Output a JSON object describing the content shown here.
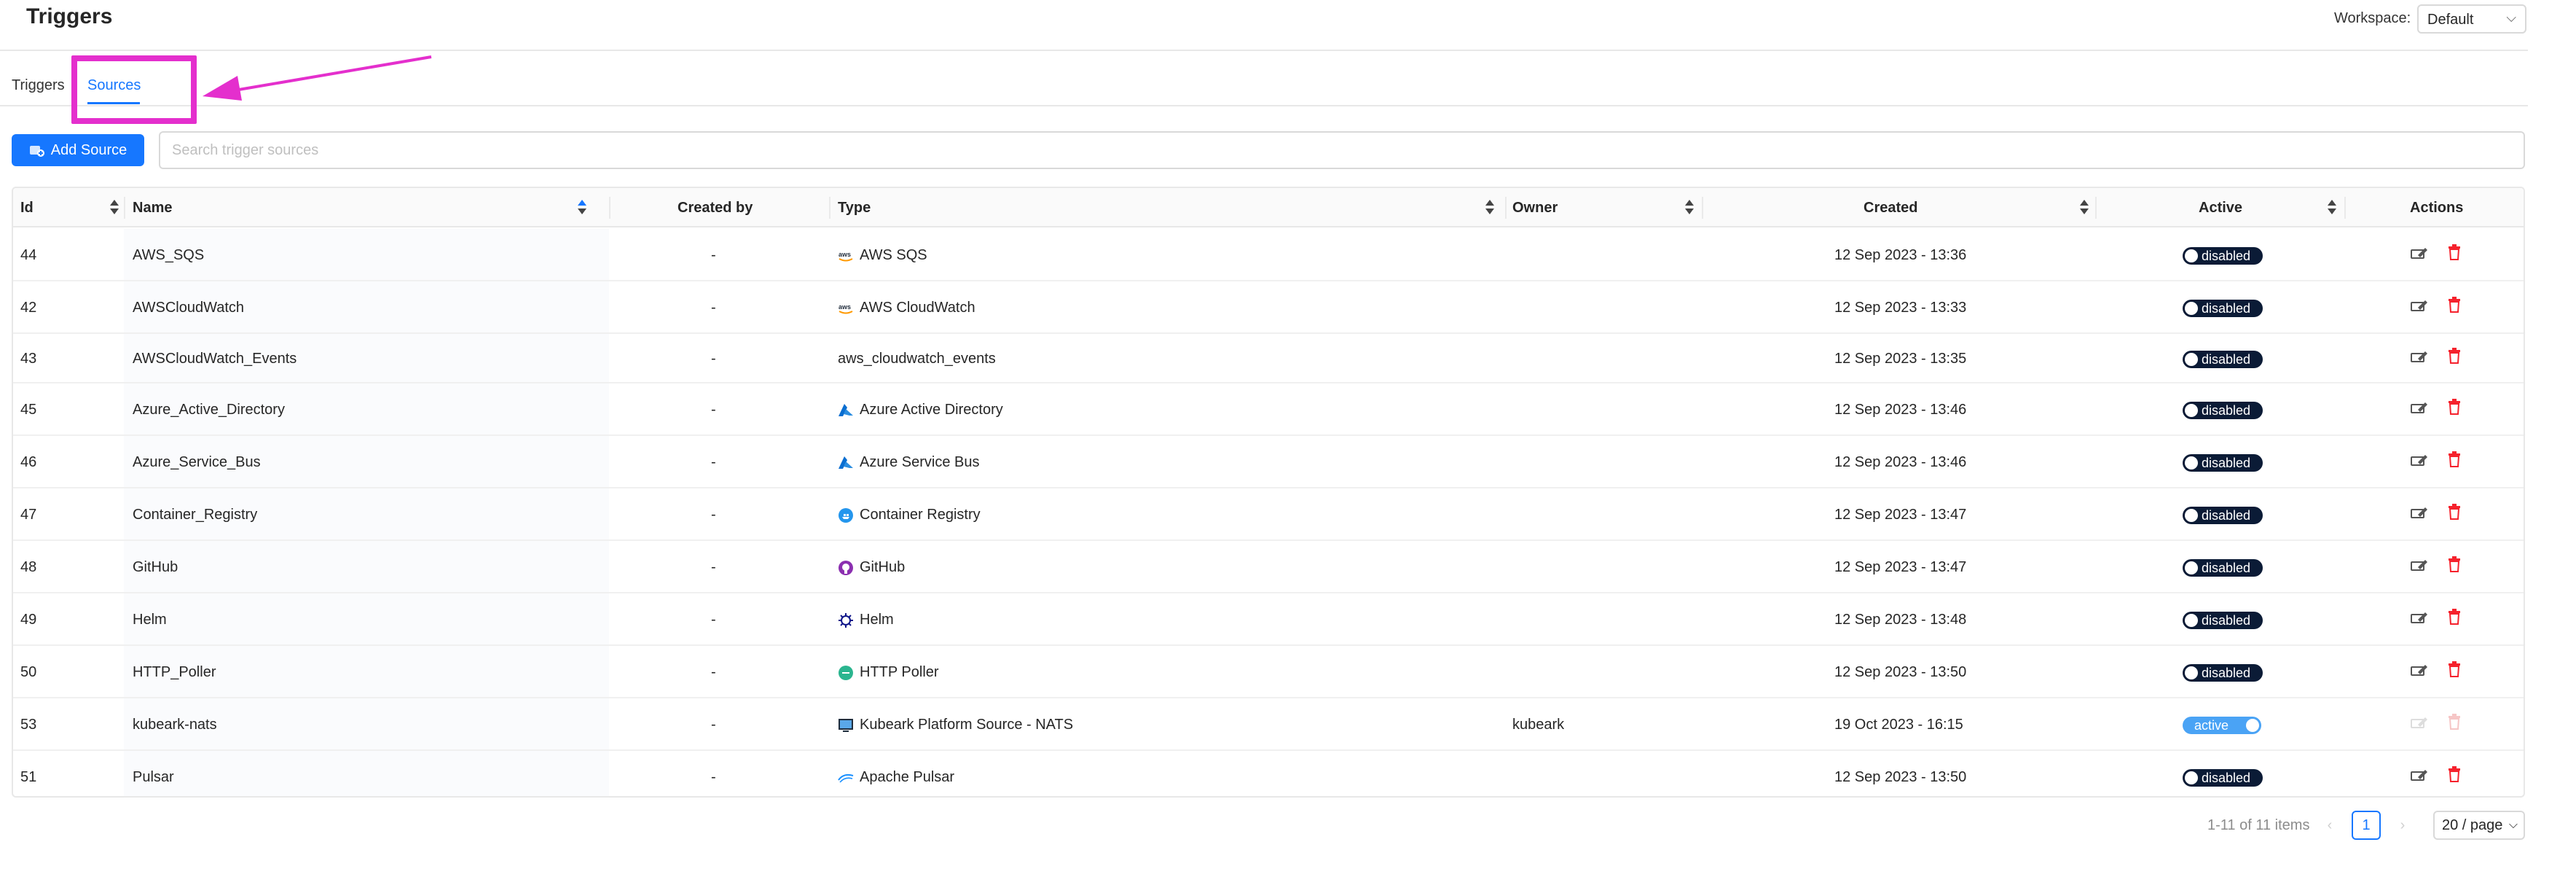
{
  "header": {
    "title": "Triggers",
    "workspace_label": "Workspace:",
    "workspace_value": "Default"
  },
  "tabs": [
    {
      "label": "Triggers",
      "active": false
    },
    {
      "label": "Sources",
      "active": true
    }
  ],
  "toolbar": {
    "add_label": "Add Source",
    "search_placeholder": "Search trigger sources"
  },
  "table": {
    "columns": [
      "Id",
      "Name",
      "Created by",
      "Type",
      "Owner",
      "Created",
      "Active",
      "Actions"
    ],
    "rows": [
      {
        "id": "44",
        "name": "AWS_SQS",
        "created_by": "-",
        "type": "AWS SQS",
        "type_icon": "aws-icon",
        "owner": "",
        "created": "12 Sep 2023 - 13:36",
        "active": "disabled",
        "enabled": false
      },
      {
        "id": "42",
        "name": "AWSCloudWatch",
        "created_by": "-",
        "type": "AWS CloudWatch",
        "type_icon": "aws-icon",
        "owner": "",
        "created": "12 Sep 2023 - 13:33",
        "active": "disabled",
        "enabled": false
      },
      {
        "id": "43",
        "name": "AWSCloudWatch_Events",
        "created_by": "-",
        "type": "aws_cloudwatch_events",
        "type_icon": "",
        "owner": "",
        "created": "12 Sep 2023 - 13:35",
        "active": "disabled",
        "enabled": false
      },
      {
        "id": "45",
        "name": "Azure_Active_Directory",
        "created_by": "-",
        "type": "Azure Active Directory",
        "type_icon": "azure-icon",
        "owner": "",
        "created": "12 Sep 2023 - 13:46",
        "active": "disabled",
        "enabled": false
      },
      {
        "id": "46",
        "name": "Azure_Service_Bus",
        "created_by": "-",
        "type": "Azure Service Bus",
        "type_icon": "azure-icon",
        "owner": "",
        "created": "12 Sep 2023 - 13:46",
        "active": "disabled",
        "enabled": false
      },
      {
        "id": "47",
        "name": "Container_Registry",
        "created_by": "-",
        "type": "Container Registry",
        "type_icon": "container-registry-icon",
        "owner": "",
        "created": "12 Sep 2023 - 13:47",
        "active": "disabled",
        "enabled": false
      },
      {
        "id": "48",
        "name": "GitHub",
        "created_by": "-",
        "type": "GitHub",
        "type_icon": "github-icon",
        "owner": "",
        "created": "12 Sep 2023 - 13:47",
        "active": "disabled",
        "enabled": false
      },
      {
        "id": "49",
        "name": "Helm",
        "created_by": "-",
        "type": "Helm",
        "type_icon": "helm-icon",
        "owner": "",
        "created": "12 Sep 2023 - 13:48",
        "active": "disabled",
        "enabled": false
      },
      {
        "id": "50",
        "name": "HTTP_Poller",
        "created_by": "-",
        "type": "HTTP Poller",
        "type_icon": "http-poller-icon",
        "owner": "",
        "created": "12 Sep 2023 - 13:50",
        "active": "disabled",
        "enabled": false
      },
      {
        "id": "53",
        "name": "kubeark-nats",
        "created_by": "-",
        "type": "Kubeark Platform Source - NATS",
        "type_icon": "kubeark-icon",
        "owner": "kubeark",
        "created": "19 Oct 2023 - 16:15",
        "active": "active",
        "enabled": true
      },
      {
        "id": "51",
        "name": "Pulsar",
        "created_by": "-",
        "type": "Apache Pulsar",
        "type_icon": "pulsar-icon",
        "owner": "",
        "created": "12 Sep 2023 - 13:50",
        "active": "disabled",
        "enabled": false
      }
    ]
  },
  "pagination": {
    "total_text": "1-11 of 11 items",
    "current_page": "1",
    "page_size": "20 / page"
  },
  "colors": {
    "primary": "#1677ff",
    "highlight": "#e42fcd",
    "toggle_off": "#0b1b36",
    "toggle_on": "#4aa3f5",
    "delete": "#f5222d"
  }
}
